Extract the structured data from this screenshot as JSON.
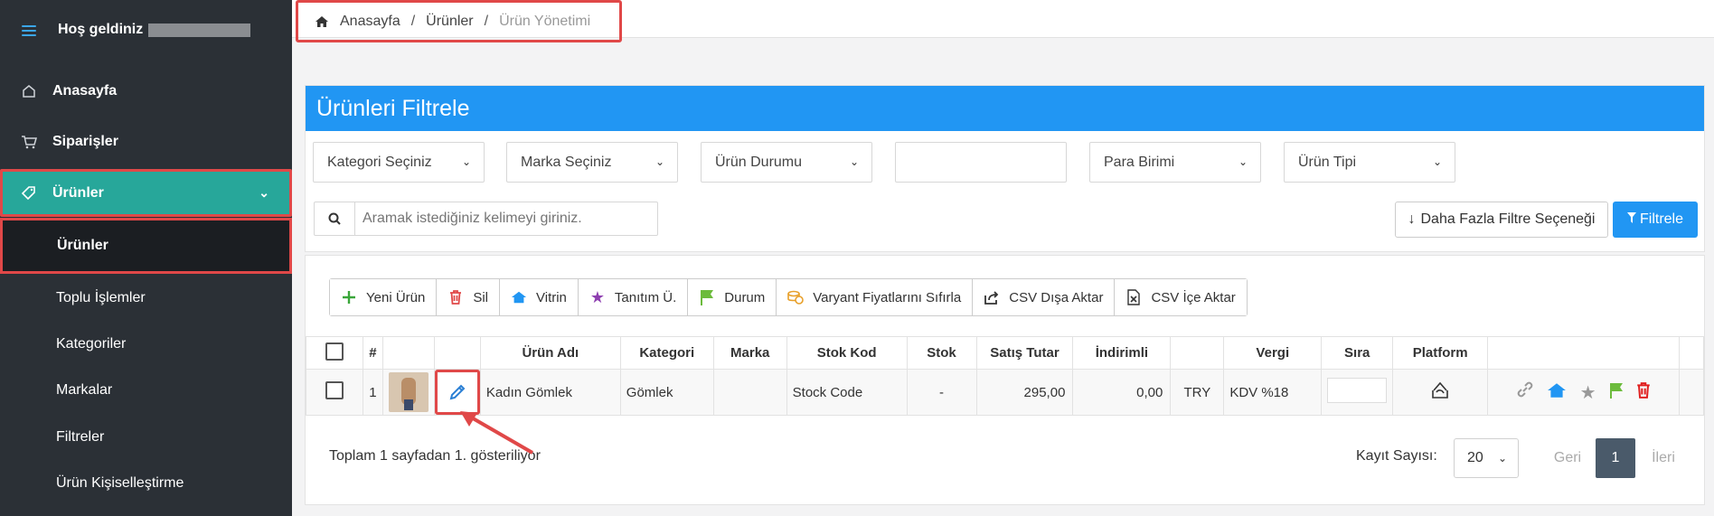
{
  "sidebar": {
    "welcome": "Hoş geldiniz",
    "items": [
      {
        "label": "Anasayfa",
        "icon": "home-outline-icon"
      },
      {
        "label": "Siparişler",
        "icon": "cart-icon"
      },
      {
        "label": "Ürünler",
        "icon": "tag-icon"
      }
    ],
    "sub_items": [
      "Ürünler",
      "Toplu İşlemler",
      "Kategoriler",
      "Markalar",
      "Filtreler",
      "Ürün Kişiselleştirme"
    ]
  },
  "breadcrumb": {
    "home": "Anasayfa",
    "section": "Ürünler",
    "current": "Ürün Yönetimi"
  },
  "filter_panel": {
    "title": "Ürünleri Filtrele",
    "selects": [
      "Kategori Seçiniz",
      "Marka Seçiniz",
      "Ürün Durumu",
      "",
      "Para Birimi",
      "Ürün Tipi"
    ],
    "search_placeholder": "Aramak istediğiniz kelimeyi giriniz.",
    "more_filters_label": "Daha Fazla Filtre Seçeneği",
    "filter_label": "Filtrele"
  },
  "toolbar": {
    "new": "Yeni Ürün",
    "delete": "Sil",
    "showcase": "Vitrin",
    "promo": "Tanıtım Ü.",
    "status": "Durum",
    "reset_variants": "Varyant Fiyatlarını Sıfırla",
    "csv_export": "CSV Dışa Aktar",
    "csv_import": "CSV İçe Aktar"
  },
  "table": {
    "headers": [
      "#",
      "Ürün Adı",
      "Kategori",
      "Marka",
      "Stok Kod",
      "Stok",
      "Satış Tutar",
      "İndirimli",
      "Vergi",
      "Sıra",
      "Platform"
    ],
    "row": {
      "index": "1",
      "name": "Kadın Gömlek",
      "category": "Gömlek",
      "brand": "",
      "stock_code": "Stock Code",
      "stock": "-",
      "price": "295,00",
      "discounted": "0,00",
      "currency": "TRY",
      "tax": "KDV %18"
    }
  },
  "footer": {
    "summary": "Toplam 1 sayfadan 1. gösteriliyor",
    "record_label": "Kayıt Sayısı:",
    "record_count": "20",
    "prev": "Geri",
    "page": "1",
    "next": "İleri"
  },
  "colors": {
    "sidebar": "#2b3036",
    "accent": "#2196f3",
    "active": "#27a79a",
    "highlight": "#e04848"
  }
}
